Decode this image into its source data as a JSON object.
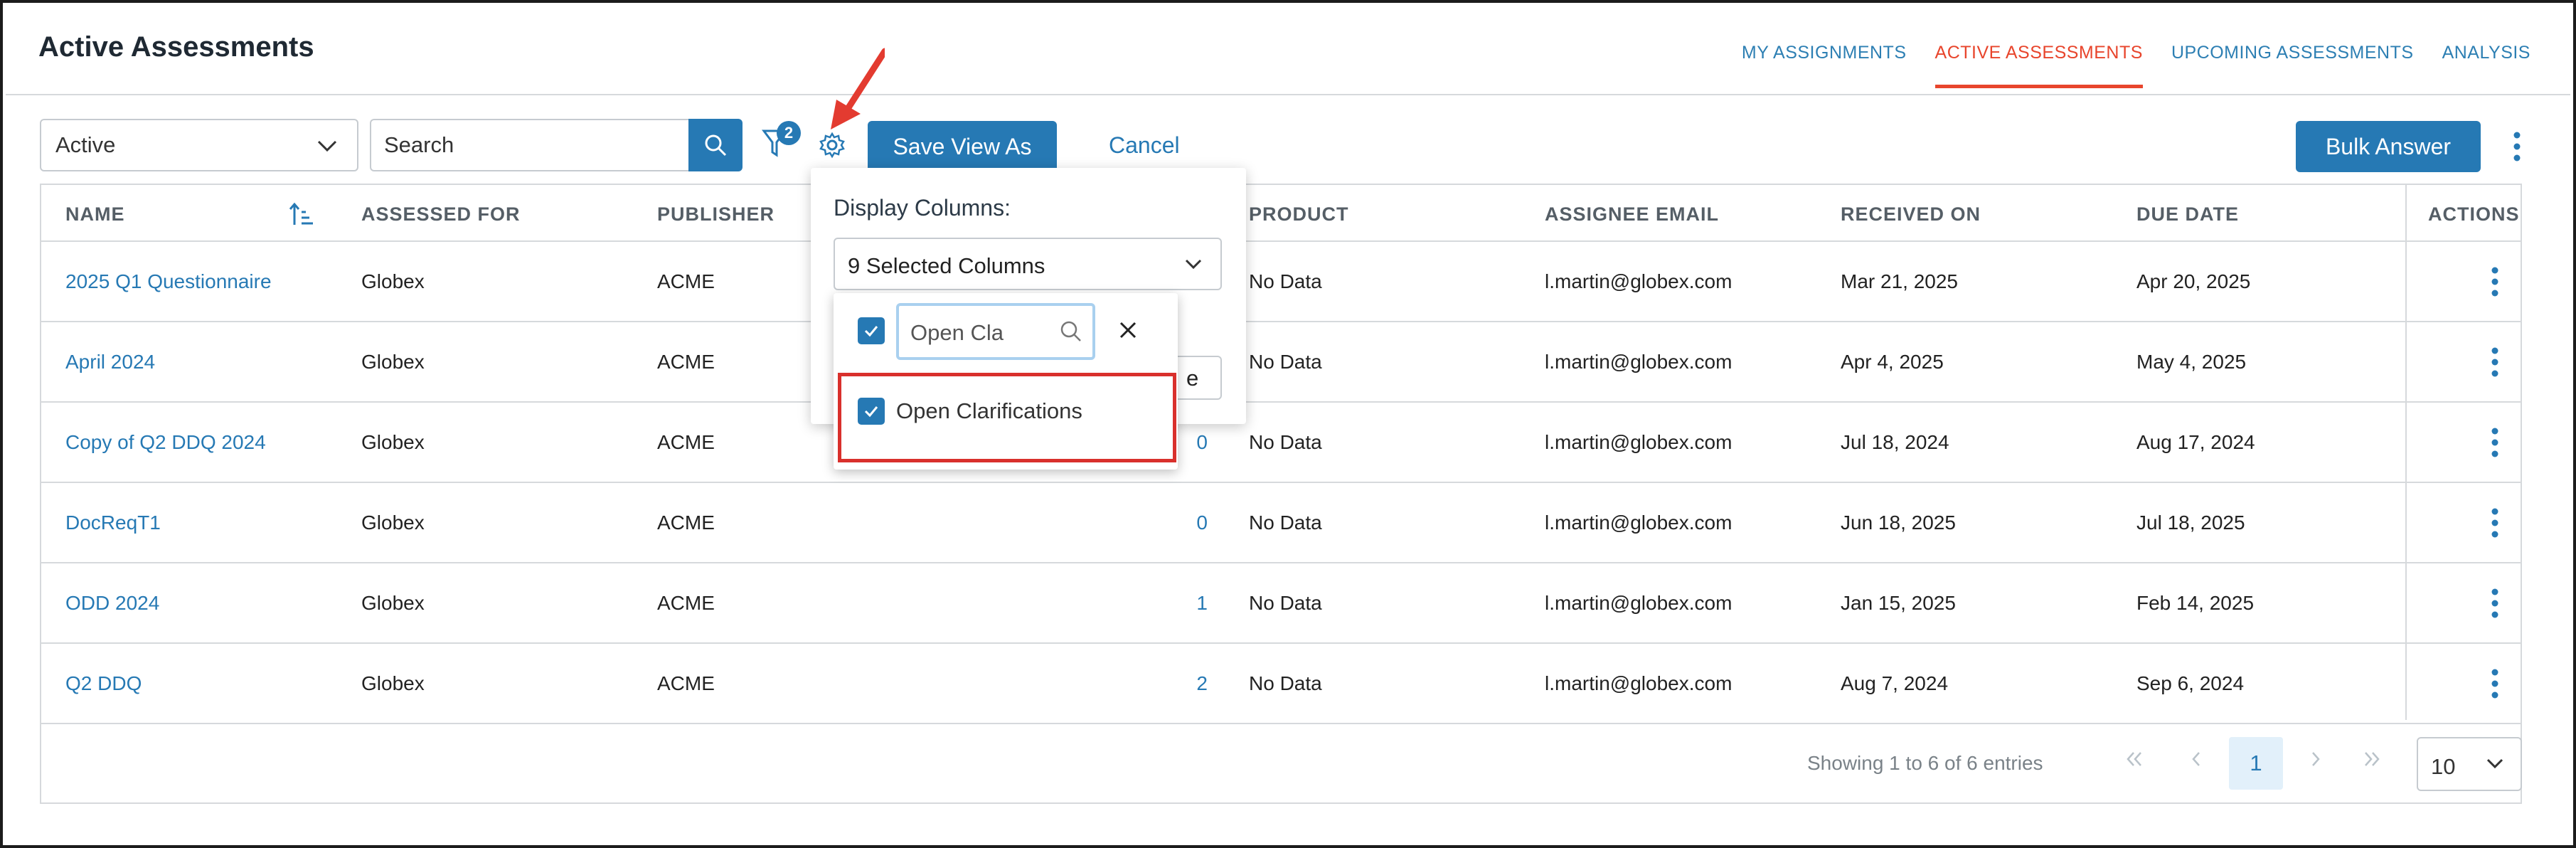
{
  "header": {
    "title": "Active Assessments",
    "tabs": [
      {
        "label": "MY ASSIGNMENTS",
        "active": false
      },
      {
        "label": "ACTIVE ASSESSMENTS",
        "active": true
      },
      {
        "label": "UPCOMING ASSESSMENTS",
        "active": false
      },
      {
        "label": "ANALYSIS",
        "active": false
      }
    ]
  },
  "toolbar": {
    "status_select": "Active",
    "search_placeholder": "Search",
    "filter_count": "2",
    "save_view_label": "Save View As",
    "cancel_label": "Cancel",
    "bulk_answer_label": "Bulk Answer"
  },
  "table": {
    "columns": [
      "NAME",
      "ASSESSED FOR",
      "PUBLISHER",
      "PRODUCT",
      "ASSIGNEE EMAIL",
      "RECEIVED ON",
      "DUE DATE",
      "ACTIONS"
    ],
    "rows": [
      {
        "name": "2025 Q1 Questionnaire",
        "assessed_for": "Globex",
        "publisher": "ACME",
        "count": "",
        "product": "No Data",
        "email": "l.martin@globex.com",
        "received": "Mar 21, 2025",
        "due": "Apr 20, 2025"
      },
      {
        "name": "April 2024",
        "assessed_for": "Globex",
        "publisher": "ACME",
        "count": "",
        "product": "No Data",
        "email": "l.martin@globex.com",
        "received": "Apr 4, 2025",
        "due": "May 4, 2025"
      },
      {
        "name": "Copy of Q2 DDQ 2024",
        "assessed_for": "Globex",
        "publisher": "ACME",
        "count": "0",
        "product": "No Data",
        "email": "l.martin@globex.com",
        "received": "Jul 18, 2024",
        "due": "Aug 17, 2024"
      },
      {
        "name": "DocReqT1",
        "assessed_for": "Globex",
        "publisher": "ACME",
        "count": "0",
        "product": "No Data",
        "email": "l.martin@globex.com",
        "received": "Jun 18, 2025",
        "due": "Jul 18, 2025"
      },
      {
        "name": "ODD 2024",
        "assessed_for": "Globex",
        "publisher": "ACME",
        "count": "1",
        "product": "No Data",
        "email": "l.martin@globex.com",
        "received": "Jan 15, 2025",
        "due": "Feb 14, 2025"
      },
      {
        "name": "Q2 DDQ",
        "assessed_for": "Globex",
        "publisher": "ACME",
        "count": "2",
        "product": "No Data",
        "email": "l.martin@globex.com",
        "received": "Aug 7, 2024",
        "due": "Sep 6, 2024"
      }
    ]
  },
  "footer": {
    "showing": "Showing 1 to 6 of 6 entries",
    "current_page": "1",
    "page_size": "10"
  },
  "popover": {
    "label": "Display Columns:",
    "selected": "9 Selected Columns",
    "ghost_text": "e",
    "filter_value": "Open Cla",
    "option_label": "Open Clarifications"
  },
  "colors": {
    "accent": "#2679b4",
    "active_tab": "#e8452c",
    "highlight": "#d9302c"
  }
}
